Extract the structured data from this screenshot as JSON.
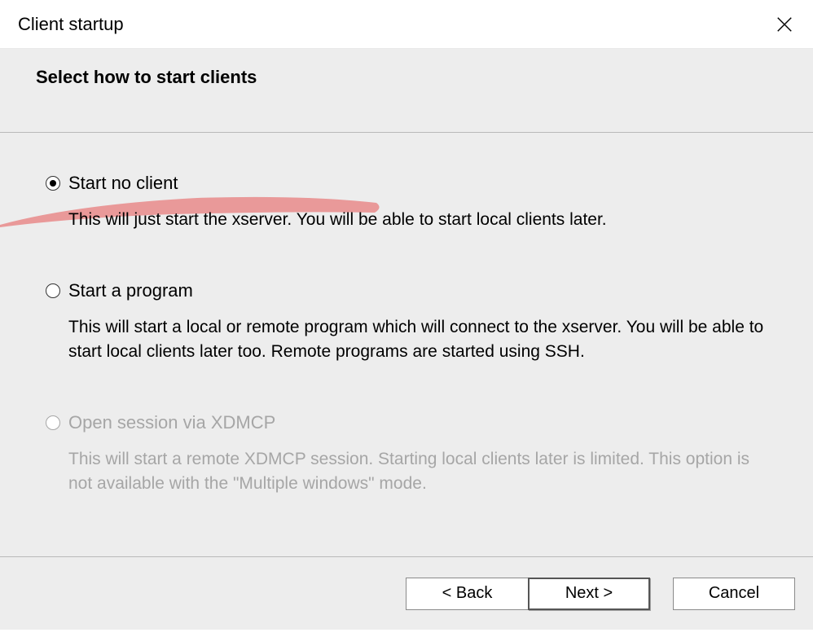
{
  "window": {
    "title": "Client startup"
  },
  "header": {
    "title": "Select how to start clients"
  },
  "options": [
    {
      "label": "Start no client",
      "description": "This will just start the xserver. You will be able to start local clients later.",
      "selected": true,
      "enabled": true
    },
    {
      "label": "Start a program",
      "description": "This will start a local or remote program which will connect to the xserver. You will be able to start local clients later too. Remote programs are started using SSH.",
      "selected": false,
      "enabled": true
    },
    {
      "label": "Open session via XDMCP",
      "description": "This will start a remote XDMCP session. Starting local clients later is limited. This option is not available with the \"Multiple windows\" mode.",
      "selected": false,
      "enabled": false
    }
  ],
  "buttons": {
    "back": "< Back",
    "next": "Next >",
    "cancel": "Cancel"
  },
  "annotation": {
    "highlight_color": "#e88a8a"
  }
}
